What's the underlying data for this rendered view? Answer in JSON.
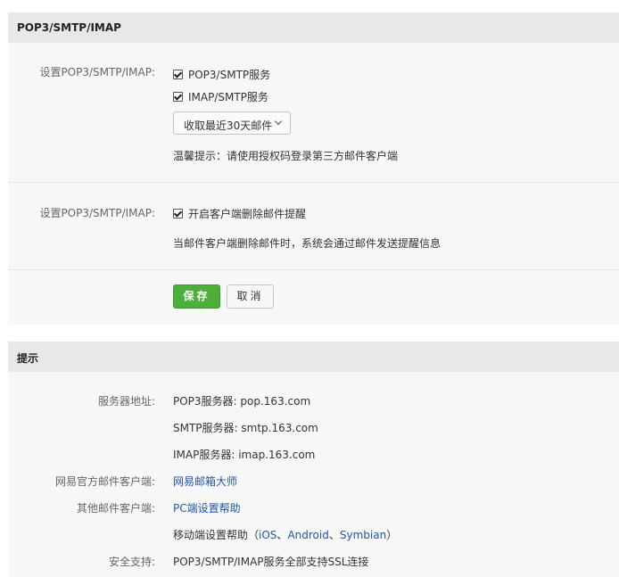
{
  "pop3_section": {
    "title": "POP3/SMTP/IMAP",
    "row1_label": "设置POP3/SMTP/IMAP:",
    "checkbox_pop3": {
      "label": "POP3/SMTP服务",
      "checked": true
    },
    "checkbox_imap": {
      "label": "IMAP/SMTP服务",
      "checked": true
    },
    "receive_select": {
      "value": "收取最近30天邮件"
    },
    "hint": "温馨提示：请使用授权码登录第三方邮件客户端",
    "row2_label": "设置POP3/SMTP/IMAP:",
    "checkbox_delete_alert": {
      "label": "开启客户端删除邮件提醒",
      "checked": true
    },
    "delete_alert_desc": "当邮件客户端删除邮件时，系统会通过邮件发送提醒信息",
    "save_label": "保存",
    "cancel_label": "取消"
  },
  "tips_section": {
    "title": "提示",
    "server_label": "服务器地址:",
    "pop3_server": "POP3服务器: pop.163.com",
    "smtp_server": "SMTP服务器: smtp.163.com",
    "imap_server": "IMAP服务器: imap.163.com",
    "official_client_label": "网易官方邮件客户端:",
    "official_client_link": "网易邮箱大师",
    "other_client_label": "其他邮件客户端:",
    "pc_help_link": "PC端设置帮助",
    "mobile_help_prefix": "移动端设置帮助（",
    "mobile_ios": "iOS",
    "sep1": "、",
    "mobile_android": "Android",
    "sep2": "、",
    "mobile_symbian": "Symbian",
    "mobile_help_suffix": "）",
    "security_label": "安全支持:",
    "security_value": "POP3/SMTP/IMAP服务全部支持SSL连接"
  },
  "colors": {
    "panel_bg": "#f7f7f7",
    "header_bg": "#e8e8e8",
    "save_button": "#4caf3a",
    "link": "#1f5aa8"
  }
}
